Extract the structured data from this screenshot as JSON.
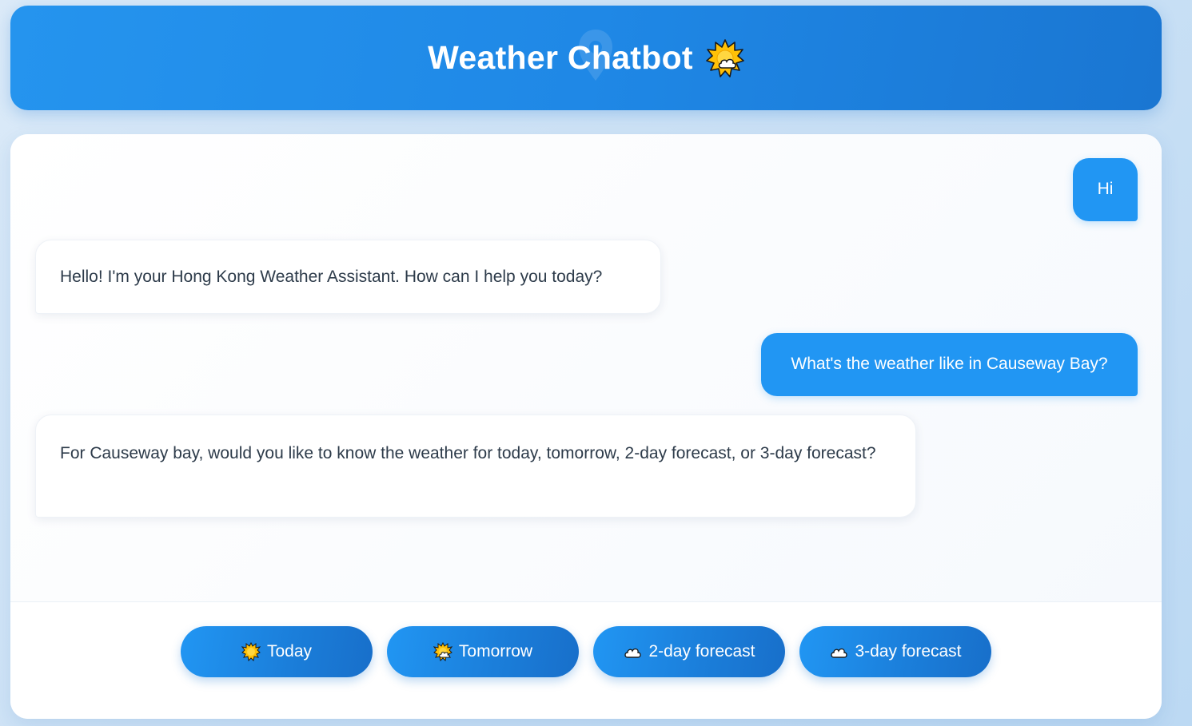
{
  "header": {
    "title": "Weather Chatbot",
    "title_icon": "sun-behind-cloud-icon"
  },
  "chat": {
    "messages": [
      {
        "role": "user",
        "text": "Hi"
      },
      {
        "role": "bot",
        "text": "Hello! I'm your Hong Kong Weather Assistant. How can I help you today?"
      },
      {
        "role": "user",
        "text": "What's the weather like in Causeway Bay?"
      },
      {
        "role": "bot",
        "text": "For Causeway bay, would you like to know the weather for today, tomorrow, 2-day forecast, or 3-day forecast?"
      }
    ]
  },
  "quick_replies": [
    {
      "label": "Today",
      "icon": "sun-icon"
    },
    {
      "label": "Tomorrow",
      "icon": "sun-behind-cloud-icon"
    },
    {
      "label": "2-day forecast",
      "icon": "cloud-icon"
    },
    {
      "label": "3-day forecast",
      "icon": "cloud-icon"
    }
  ],
  "colors": {
    "header_blue": "#2196f3",
    "user_bubble": "#2196f3",
    "button_blue": "#1b7fdb",
    "bot_text": "#2d3b4a"
  }
}
